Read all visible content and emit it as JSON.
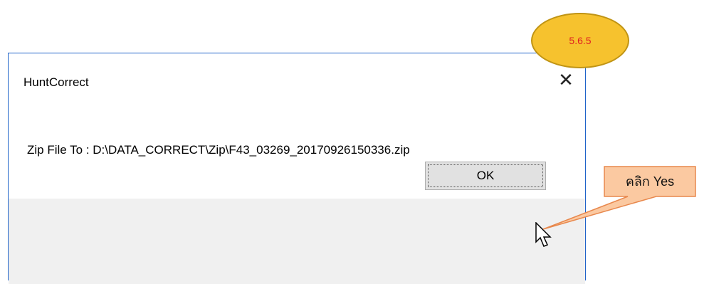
{
  "dialog": {
    "title": "HuntCorrect",
    "close_symbol": "✕",
    "message": "Zip File To : D:\\DATA_CORRECT\\Zip\\F43_03269_20170926150336.zip",
    "ok_label": "OK"
  },
  "annotations": {
    "step_badge": "5.6.5",
    "callout_text": "คลิก Yes"
  },
  "colors": {
    "badge_fill": "#f6c22e",
    "badge_text": "#e02020",
    "callout_fill": "#fbc9a1",
    "callout_border": "#e8884d",
    "dialog_border": "#1f63c9"
  }
}
